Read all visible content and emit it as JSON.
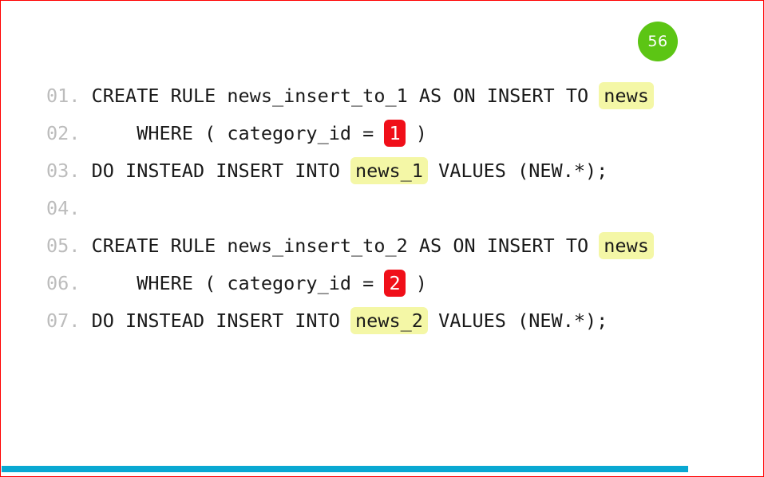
{
  "slide": {
    "page_badge": {
      "number": "56",
      "color": "#5cc514",
      "text_color": "#ffffff"
    },
    "border_color": "#ff0000",
    "background": "#ffffff"
  },
  "code": {
    "language": "sql",
    "text_color": "#1a1a1a",
    "lineno_color": "#bcbcbc",
    "highlight_yellow": "#f4f7a6",
    "highlight_red": "#f00f19",
    "lines": [
      {
        "number": "01.",
        "segments": [
          {
            "text": "CREATE RULE news_insert_to_1 AS ON INSERT TO ",
            "style": "plain"
          },
          {
            "text": "news",
            "style": "yellow"
          }
        ]
      },
      {
        "number": "02.",
        "segments": [
          {
            "text": "    WHERE ( category_id = ",
            "style": "plain"
          },
          {
            "text": "1",
            "style": "red"
          },
          {
            "text": " )",
            "style": "plain"
          }
        ]
      },
      {
        "number": "03.",
        "segments": [
          {
            "text": "DO INSTEAD INSERT INTO ",
            "style": "plain"
          },
          {
            "text": "news_1",
            "style": "yellow"
          },
          {
            "text": " VALUES (NEW.*);",
            "style": "plain"
          }
        ]
      },
      {
        "number": "04.",
        "segments": [
          {
            "text": "",
            "style": "plain"
          }
        ]
      },
      {
        "number": "05.",
        "segments": [
          {
            "text": "CREATE RULE news_insert_to_2 AS ON INSERT TO ",
            "style": "plain"
          },
          {
            "text": "news",
            "style": "yellow"
          }
        ]
      },
      {
        "number": "06.",
        "segments": [
          {
            "text": "    WHERE ( category_id = ",
            "style": "plain"
          },
          {
            "text": "2",
            "style": "red"
          },
          {
            "text": " )",
            "style": "plain"
          }
        ]
      },
      {
        "number": "07.",
        "segments": [
          {
            "text": "DO INSTEAD INSERT INTO ",
            "style": "plain"
          },
          {
            "text": "news_2",
            "style": "yellow"
          },
          {
            "text": " VALUES (NEW.*);",
            "style": "plain"
          }
        ]
      }
    ]
  },
  "progress": {
    "percent": 90,
    "color": "#0aa8d2"
  }
}
